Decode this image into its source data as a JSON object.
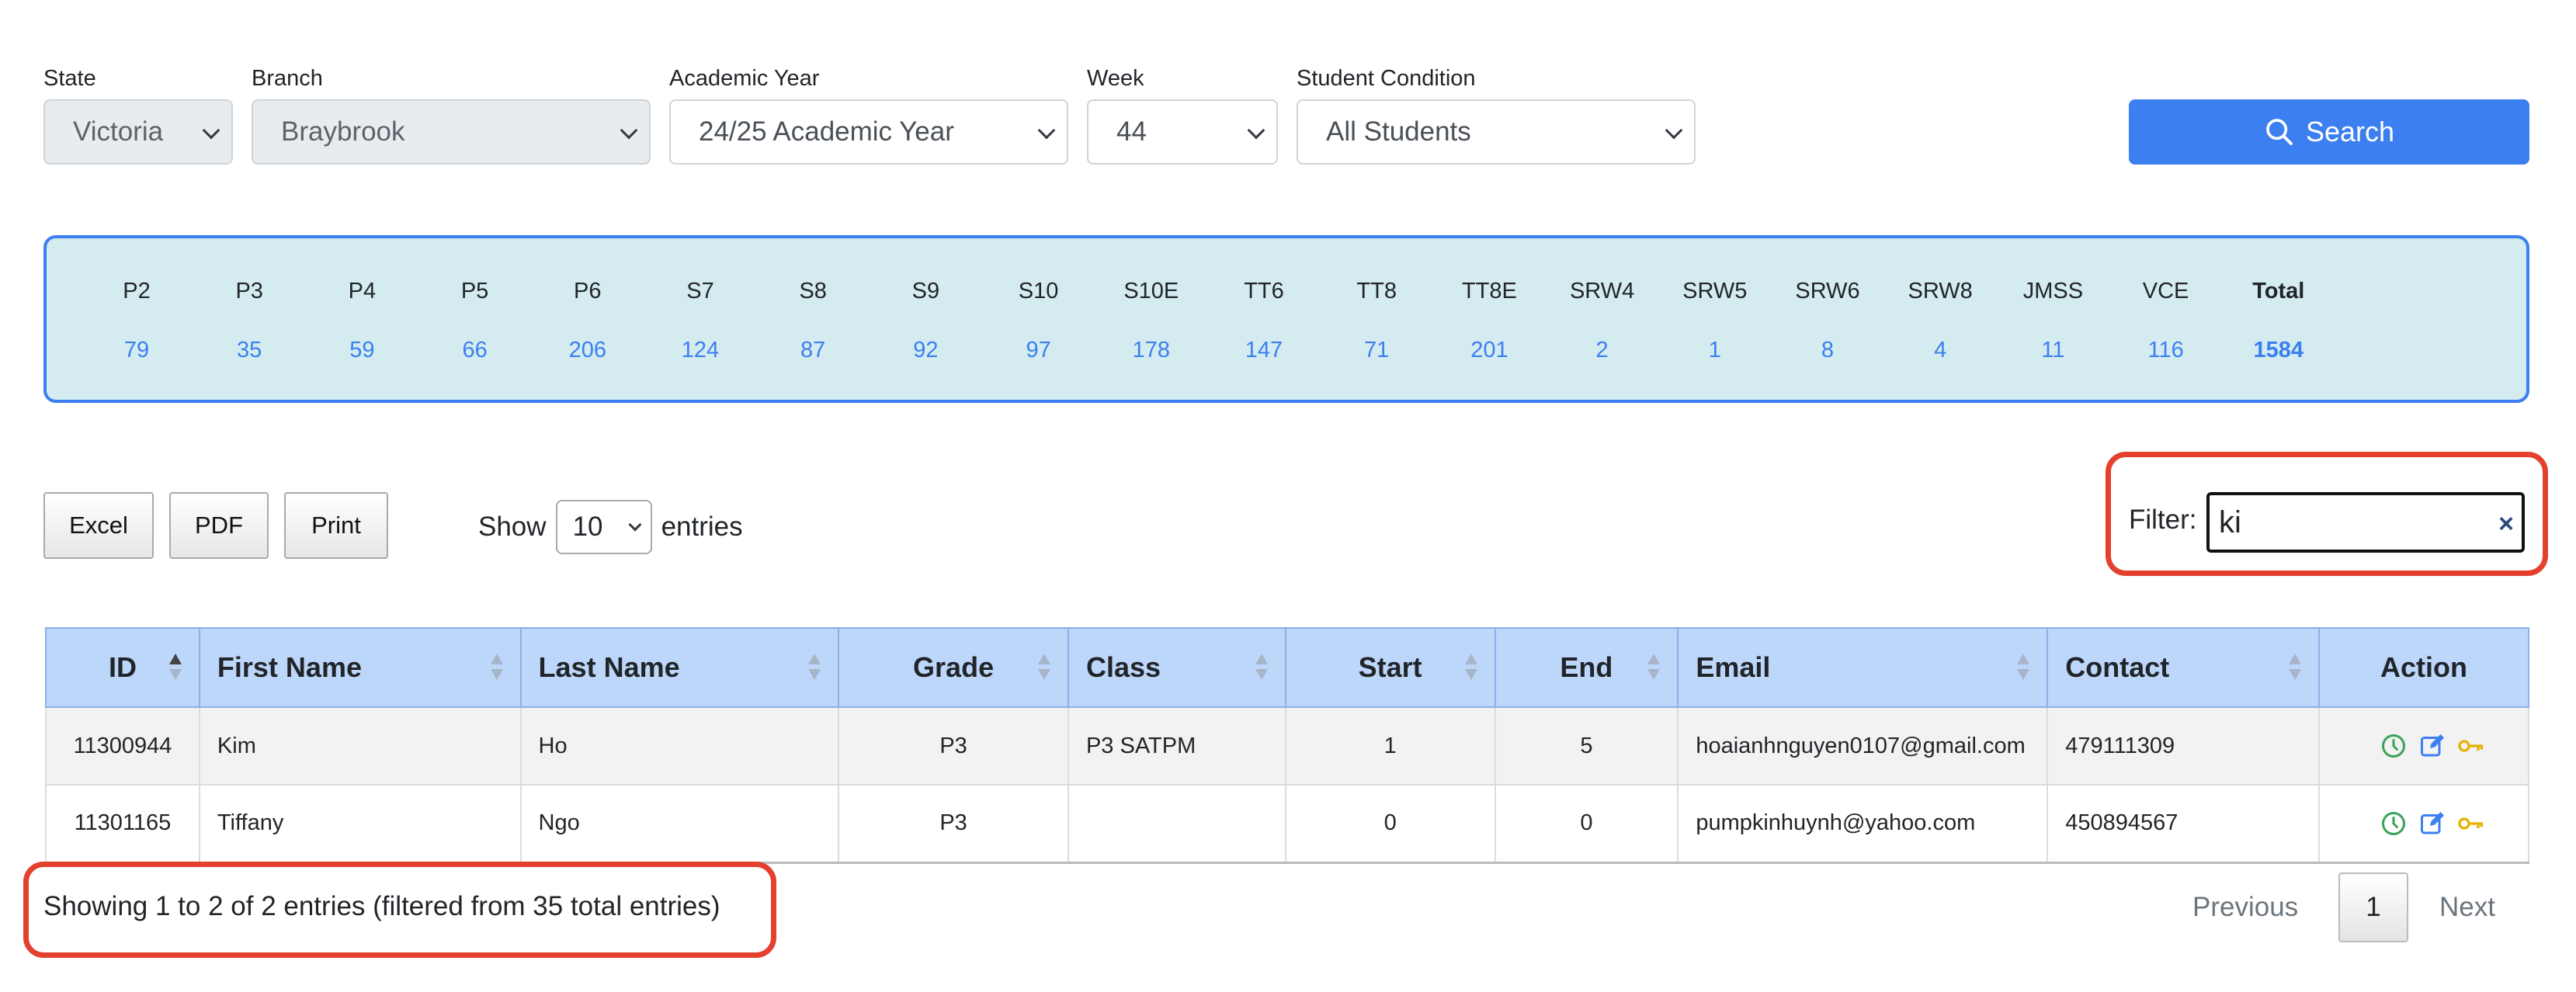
{
  "filters": {
    "state": {
      "label": "State",
      "value": "Victoria"
    },
    "branch": {
      "label": "Branch",
      "value": "Braybrook"
    },
    "academic_year": {
      "label": "Academic Year",
      "value": "24/25 Academic Year"
    },
    "week": {
      "label": "Week",
      "value": "44"
    },
    "student_condition": {
      "label": "Student Condition",
      "value": "All Students"
    },
    "search_label": "Search"
  },
  "summary": [
    {
      "label": "P2",
      "value": "79"
    },
    {
      "label": "P3",
      "value": "35"
    },
    {
      "label": "P4",
      "value": "59"
    },
    {
      "label": "P5",
      "value": "66"
    },
    {
      "label": "P6",
      "value": "206"
    },
    {
      "label": "S7",
      "value": "124"
    },
    {
      "label": "S8",
      "value": "87"
    },
    {
      "label": "S9",
      "value": "92"
    },
    {
      "label": "S10",
      "value": "97"
    },
    {
      "label": "S10E",
      "value": "178"
    },
    {
      "label": "TT6",
      "value": "147"
    },
    {
      "label": "TT8",
      "value": "71"
    },
    {
      "label": "TT8E",
      "value": "201"
    },
    {
      "label": "SRW4",
      "value": "2"
    },
    {
      "label": "SRW5",
      "value": "1"
    },
    {
      "label": "SRW6",
      "value": "8"
    },
    {
      "label": "SRW8",
      "value": "4"
    },
    {
      "label": "JMSS",
      "value": "11"
    },
    {
      "label": "VCE",
      "value": "116"
    },
    {
      "label": "Total",
      "value": "1584"
    }
  ],
  "toolbar": {
    "excel": "Excel",
    "pdf": "PDF",
    "print": "Print",
    "show_label": "Show",
    "show_value": "10",
    "entries_label": "entries",
    "filter_label": "Filter:",
    "filter_value": "ki",
    "clear_icon": "×"
  },
  "table": {
    "headers": [
      "ID",
      "First Name",
      "Last Name",
      "Grade",
      "Class",
      "Start",
      "End",
      "Email",
      "Contact",
      "Action"
    ],
    "rows": [
      {
        "id": "11300944",
        "first": "Kim",
        "last": "Ho",
        "grade": "P3",
        "class": "P3 SATPM",
        "start": "1",
        "end": "5",
        "email": "hoaianhnguyen0107@gmail.com",
        "contact": "479111309"
      },
      {
        "id": "11301165",
        "first": "Tiffany",
        "last": "Ngo",
        "grade": "P3",
        "class": "",
        "start": "0",
        "end": "0",
        "email": "pumpkinhuynh@yahoo.com",
        "contact": "450894567"
      }
    ],
    "action_icons": [
      "history-icon",
      "edit-icon",
      "key-icon"
    ]
  },
  "footer": {
    "info": "Showing 1 to 2 of 2 entries (filtered from 35 total entries)",
    "previous": "Previous",
    "current_page": "1",
    "next": "Next"
  },
  "colors": {
    "primary": "#3b7ff0",
    "highlight": "#e4402e",
    "summary_bg": "#d4ebf0",
    "header_bg": "#bdd7fb"
  }
}
